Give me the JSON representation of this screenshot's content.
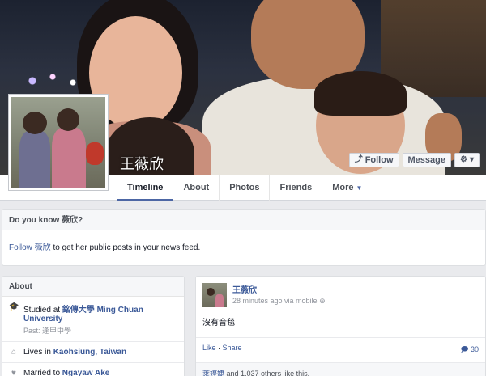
{
  "profile": {
    "name": "王薇欣",
    "follow_label": "Follow",
    "message_label": "Message",
    "settings_icon": "gear-icon"
  },
  "tabs": [
    {
      "label": "Timeline"
    },
    {
      "label": "About"
    },
    {
      "label": "Photos"
    },
    {
      "label": "Friends"
    },
    {
      "label": "More"
    }
  ],
  "know": {
    "title": "Do you know 薇欣?",
    "follow_link": "Follow 薇欣",
    "text": " to get her public posts in your news feed."
  },
  "about": {
    "title": "About",
    "studied_prefix": "Studied at ",
    "studied_school": "銘傳大學 Ming Chuan University",
    "past": "Past: 逢甲中學",
    "lives_prefix": "Lives in ",
    "lives_place": "Kaohsiung, Taiwan",
    "married_prefix": "Married to ",
    "married_name": "Ngayaw Ake"
  },
  "post": {
    "author": "王薇欣",
    "meta": "28 minutes ago via mobile",
    "text": "沒有音毯",
    "like": "Like",
    "share": "Share",
    "comments": "30",
    "likes_name": "萊婷婕",
    "likes_rest": " and 1,037 others like this."
  },
  "colors": {
    "link": "#3b5998",
    "accent": "#4c66a4"
  }
}
